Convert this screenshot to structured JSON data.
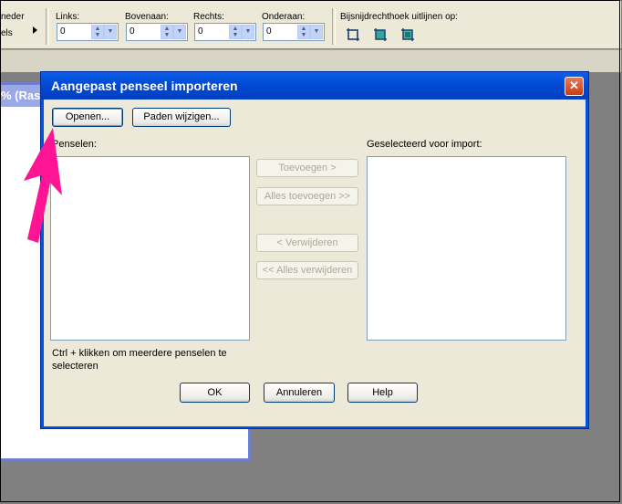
{
  "toolbar": {
    "partial_top": "neder",
    "partial_bottom": "els",
    "fields": [
      {
        "label": "Links:",
        "value": "0"
      },
      {
        "label": "Bovenaan:",
        "value": "0"
      },
      {
        "label": "Rechts:",
        "value": "0"
      },
      {
        "label": "Onderaan:",
        "value": "0"
      }
    ],
    "align_label": "Bijsnijdrechthoek uitlijnen op:"
  },
  "background_window": {
    "title_partial": "% (Ras"
  },
  "dialog": {
    "title": "Aangepast penseel importeren",
    "close_glyph": "✕",
    "open_button": "Openen...",
    "paths_button": "Paden wijzigen...",
    "brushes_label": "Penselen:",
    "selected_label": "Geselecteerd voor import:",
    "add_button": "Toevoegen >",
    "add_all_button": "Alles toevoegen >>",
    "remove_button": "< Verwijderen",
    "remove_all_button": "<< Alles verwijderen",
    "hint_text": "Ctrl + klikken om meerdere penselen te selecteren",
    "ok_button": "OK",
    "cancel_button": "Annuleren",
    "help_button": "Help"
  },
  "annotation": {
    "arrow_color": "#ff1493"
  }
}
